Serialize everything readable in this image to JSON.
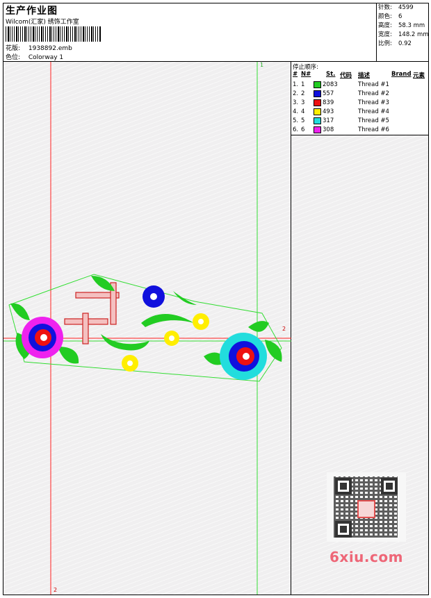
{
  "header": {
    "title": "生产作业图",
    "company": "Wilcom(汇家) 绣饰工作室",
    "file_label": "花版:",
    "file_value": "1938892.emb",
    "color_label": "色位:",
    "color_value": "Colorway 1"
  },
  "stats": [
    {
      "label": "针数:",
      "value": "4599"
    },
    {
      "label": "颜色:",
      "value": "6"
    },
    {
      "label": "高度:",
      "value": "58.3 mm"
    },
    {
      "label": "宽度:",
      "value": "148.2 mm"
    },
    {
      "label": "比例:",
      "value": "0.92"
    }
  ],
  "stop_sequence": {
    "title": "停止顺序:",
    "columns": [
      "#",
      "N#",
      "St.",
      "代码",
      "描述",
      "Brand",
      "元素"
    ],
    "rows": [
      {
        "idx": "1.",
        "n": "1",
        "color": "#22cc22",
        "stitches": "2083",
        "desc": "Thread #1"
      },
      {
        "idx": "2.",
        "n": "2",
        "color": "#1010dd",
        "stitches": "557",
        "desc": "Thread #2"
      },
      {
        "idx": "3.",
        "n": "3",
        "color": "#ee1111",
        "stitches": "839",
        "desc": "Thread #3"
      },
      {
        "idx": "4.",
        "n": "4",
        "color": "#ffee00",
        "stitches": "493",
        "desc": "Thread #4"
      },
      {
        "idx": "5.",
        "n": "5",
        "color": "#22dddd",
        "stitches": "317",
        "desc": "Thread #5"
      },
      {
        "idx": "6.",
        "n": "6",
        "color": "#ee22ee",
        "stitches": "308",
        "desc": "Thread #6"
      }
    ]
  },
  "axis_labels": {
    "green_top": "1",
    "red_right": "2",
    "red_bottom": "2"
  },
  "watermark": "6xiu.com"
}
